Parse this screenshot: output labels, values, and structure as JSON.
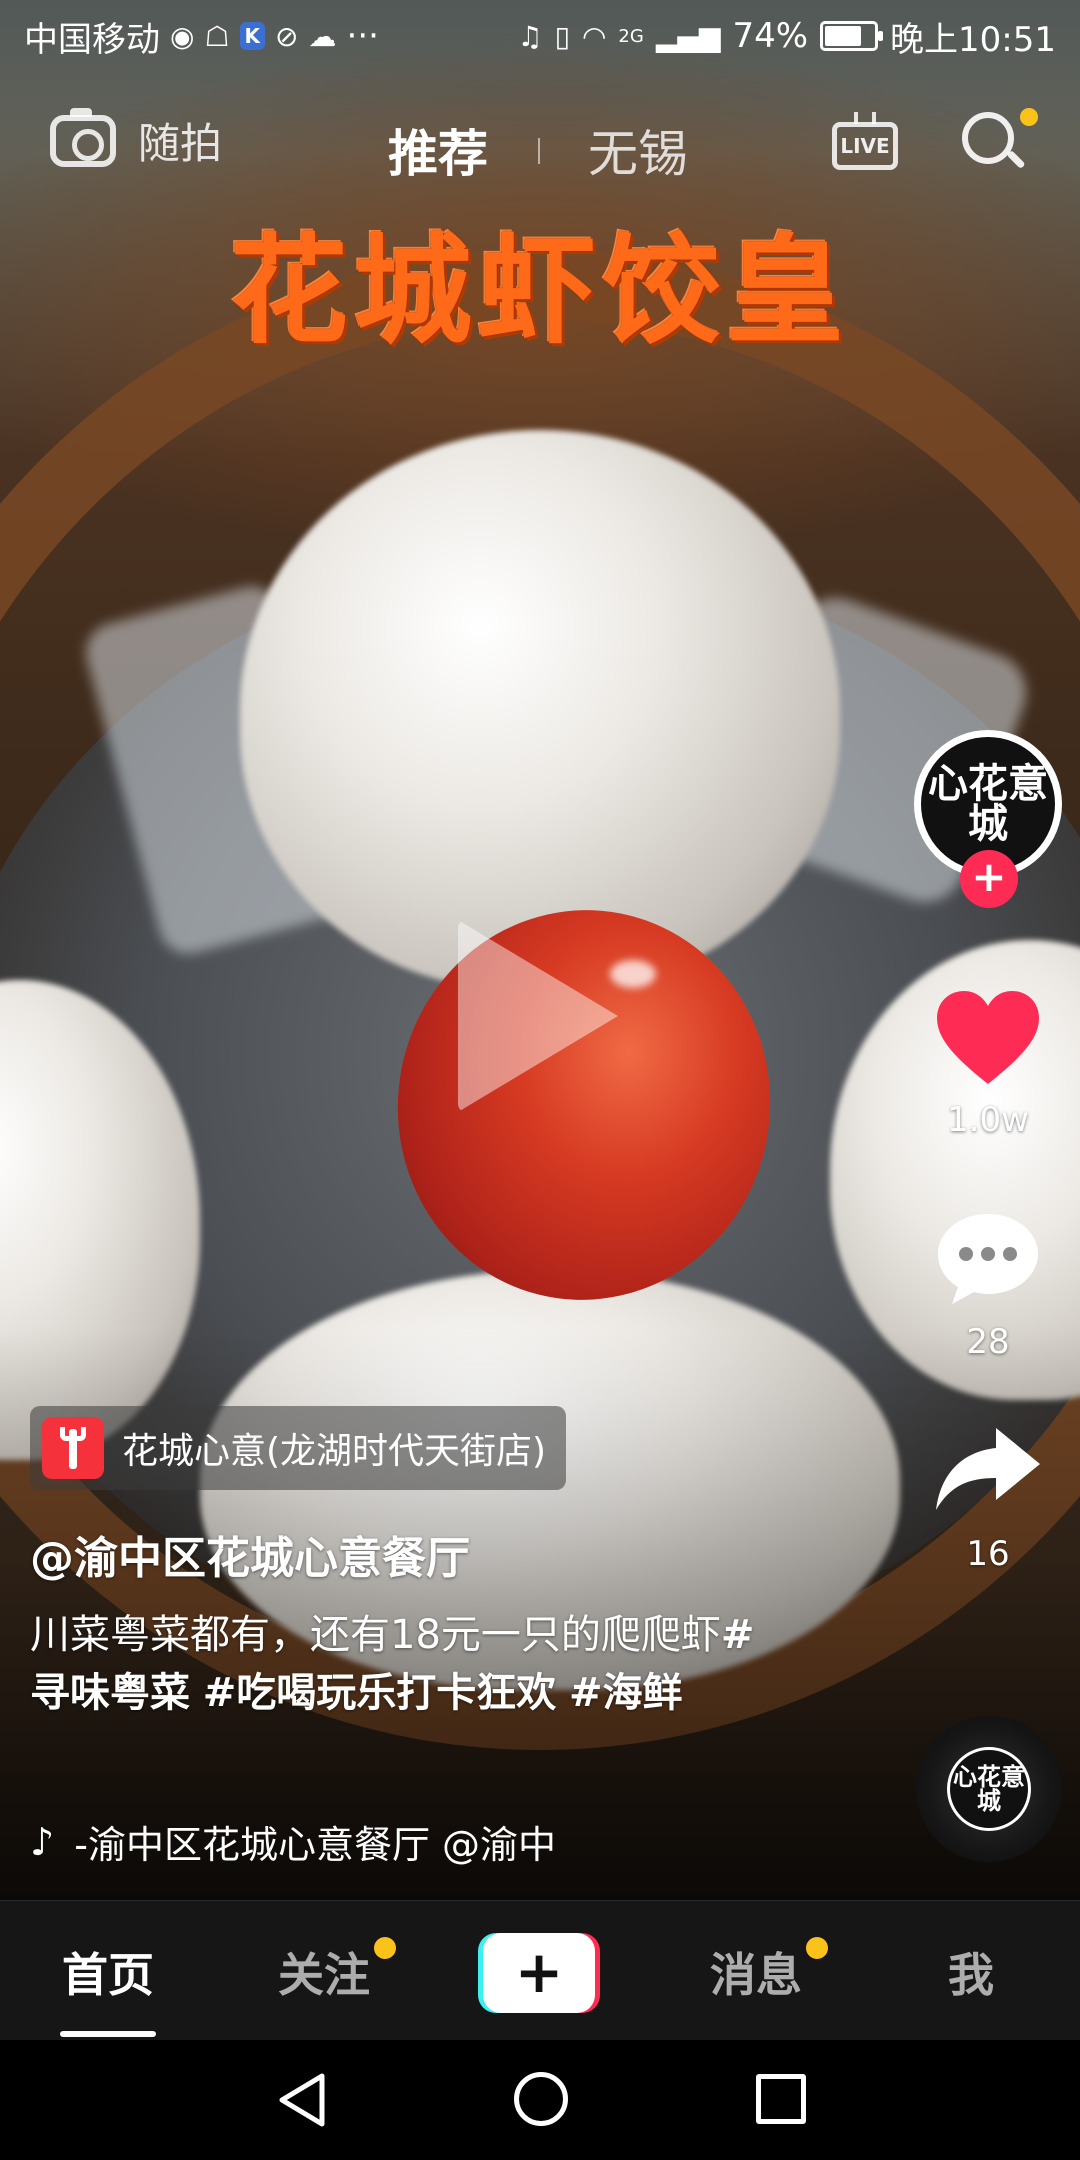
{
  "status_bar": {
    "carrier": "中国移动",
    "network": "2G",
    "battery": "74%",
    "battery_level": 0.74,
    "time": "晚上10:51",
    "more": "···"
  },
  "top_nav": {
    "camera_label": "随拍",
    "tab_recommend": "推荐",
    "tab_local": "无锡",
    "live_label": "LIVE"
  },
  "video": {
    "headline": "花城虾饺皇"
  },
  "side": {
    "avatar_text": "心花意城",
    "follow": "+",
    "likes": "1.0w",
    "comments": "28",
    "shares": "16",
    "disc_text": "心花意城"
  },
  "post": {
    "poi": "花城心意(龙湖时代天街店)",
    "author": "@渝中区花城心意餐厅",
    "caption_text": "川菜粤菜都有，还有18元一只的爬爬虾",
    "hashtag1": "#寻味粤菜",
    "hashtag2": "#吃喝玩乐打卡狂欢",
    "hashtag3": "#海鲜",
    "music": "-渝中区花城心意餐厅    @渝中区花城心意餐厅"
  },
  "bottom_nav": {
    "home": "首页",
    "follow": "关注",
    "create": "+",
    "messages": "消息",
    "me": "我"
  },
  "colors": {
    "accent": "#fe2c55",
    "notify_dot": "#fbc21a",
    "headline": "#ff6a18"
  }
}
